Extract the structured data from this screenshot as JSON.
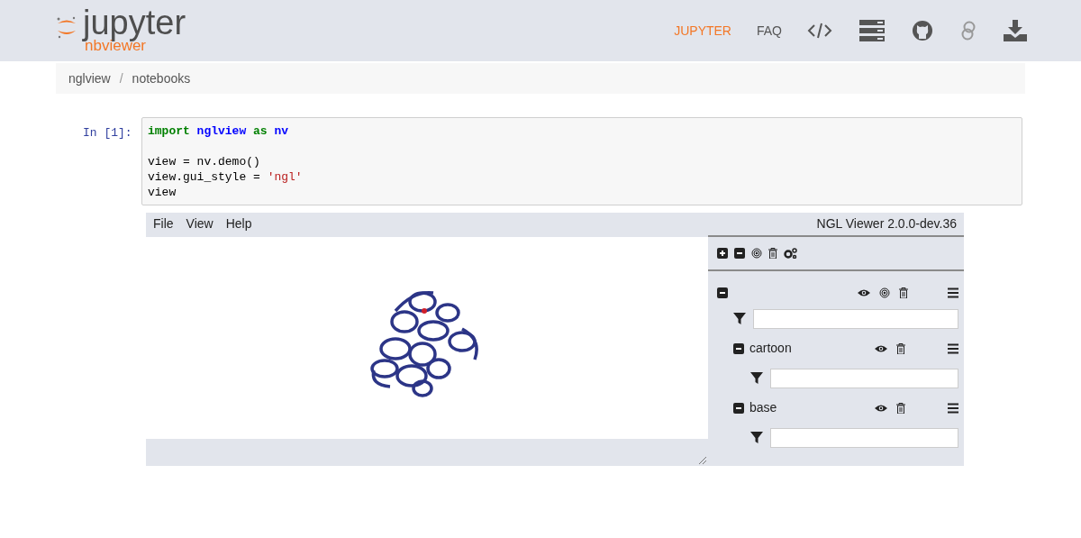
{
  "header": {
    "logo_text": "jupyter",
    "logo_subtitle": "nbviewer",
    "nav": [
      {
        "label": "JUPYTER",
        "selected": true
      },
      {
        "label": "FAQ",
        "selected": false
      }
    ]
  },
  "breadcrumbs": [
    "nglview",
    "notebooks"
  ],
  "breadcrumb_separator": "/",
  "cell": {
    "prompt": "In [1]:",
    "lines": [
      {
        "kind": "keyword",
        "text": "import "
      },
      {
        "kind": "module",
        "text": "nglview "
      },
      {
        "kind": "keyword",
        "text": "as "
      },
      {
        "kind": "module",
        "text": "nv"
      },
      {
        "kind": "plain",
        "text": "\n\nview = nv.demo()\nview.gui_style = "
      },
      {
        "kind": "string",
        "text": "'ngl'"
      },
      {
        "kind": "plain",
        "text": "\nview"
      }
    ]
  },
  "viewer": {
    "menu": [
      "File",
      "View",
      "Help"
    ],
    "version": "NGL Viewer 2.0.0-dev.36",
    "component": {
      "expanded": true,
      "representations": [
        {
          "name": "cartoon",
          "expanded": true
        },
        {
          "name": "base",
          "expanded": true
        }
      ]
    }
  }
}
